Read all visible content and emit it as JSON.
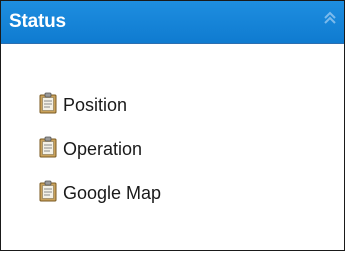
{
  "panel": {
    "title": "Status",
    "collapse_icon": "double-chevron-up-icon",
    "header_color": "#1a86d8",
    "items": [
      {
        "label": "Position",
        "icon": "clipboard-icon"
      },
      {
        "label": "Operation",
        "icon": "clipboard-icon"
      },
      {
        "label": "Google Map",
        "icon": "clipboard-icon"
      }
    ]
  }
}
